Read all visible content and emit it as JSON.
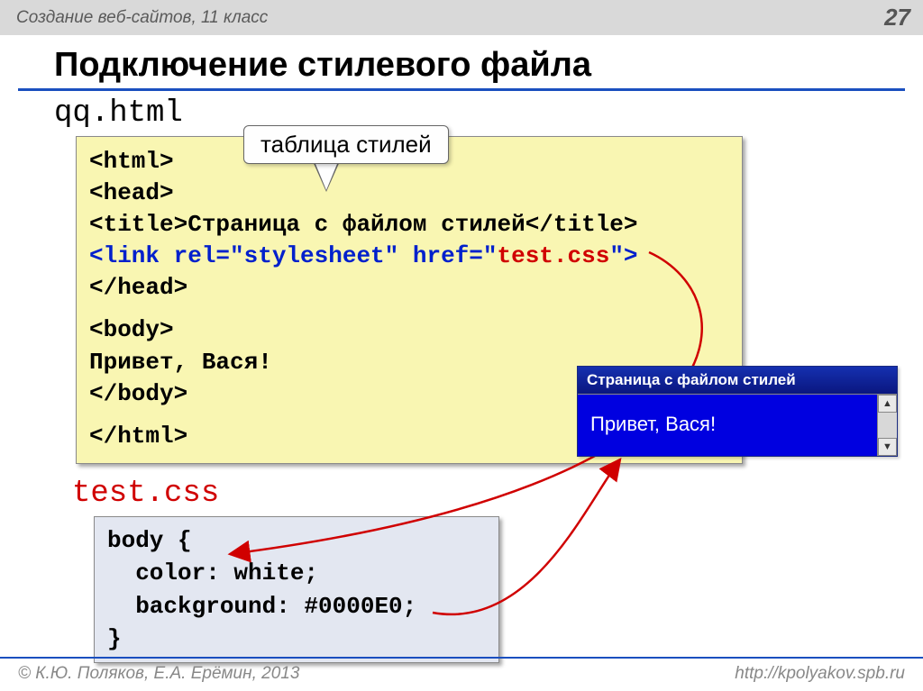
{
  "header": {
    "left": "Создание веб-сайтов, 11 класс",
    "page": "27"
  },
  "title": "Подключение стилевого файла",
  "html_filename": "qq.html",
  "css_filename": "test.css",
  "callout": "таблица стилей",
  "code_html": {
    "l1": "<html>",
    "l2": "<head>",
    "l3a": "<title>",
    "l3b": "Страница с файлом стилей",
    "l3c": "</title>",
    "l4a": "<link rel=\"stylesheet\" href=\"",
    "l4b": "test.css",
    "l4c": "\">",
    "l5": "</head>",
    "l6": "<body>",
    "l7": "Привет, Вася!",
    "l8": "</body>",
    "l9": "</html>"
  },
  "code_css": {
    "l1": "body {",
    "l2": "  color: white;",
    "l3": "  background: #0000E0;",
    "l4": "}"
  },
  "browser": {
    "title": "Страница с файлом стилей",
    "body": "Привет, Вася!",
    "up": "▲",
    "down": "▼"
  },
  "footer": {
    "left": "© К.Ю. Поляков, Е.А. Ерёмин, 2013",
    "right": "http://kpolyakov.spb.ru"
  }
}
